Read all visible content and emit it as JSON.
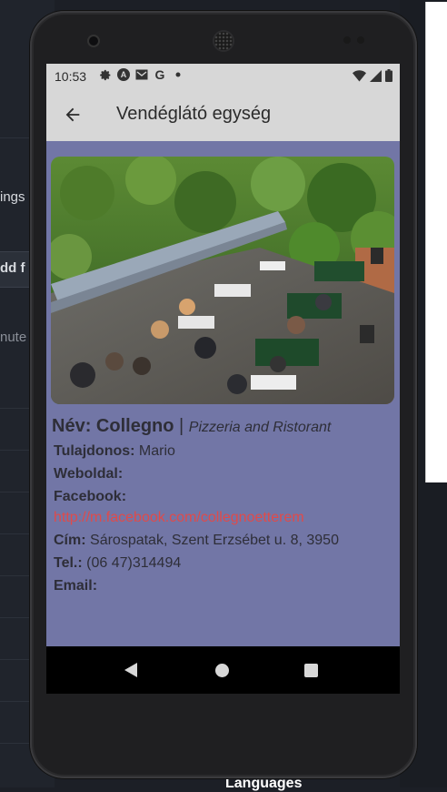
{
  "background": {
    "left_labels": [
      "ings",
      "dd f",
      "nute"
    ],
    "right_labels": [
      "ʃ"
    ],
    "bottom_label": "Languages"
  },
  "status_bar": {
    "time": "10:53",
    "icons": [
      "gear-icon",
      "a-icon",
      "mail-icon",
      "g-icon",
      "dot-icon",
      "wifi-icon",
      "signal-icon",
      "battery-icon"
    ],
    "g_label": "G",
    "a_label": "A"
  },
  "app_bar": {
    "title": "Vendéglátó egység"
  },
  "venue": {
    "name_label": "Név:",
    "name": "Collegno",
    "separator": "|",
    "type": "Pizzeria and Ristorant",
    "owner_label": "Tulajdonos:",
    "owner": "Mario",
    "website_label": "Weboldal:",
    "website": "",
    "facebook_label": "Facebook:",
    "facebook": "http://m.facebook.com/collegnoetterem",
    "address_label": "Cím:",
    "address": "Sárospatak, Szent Erzsébet u. 8, 3950",
    "phone_label": "Tel.:",
    "phone": "(06 47)314494",
    "email_label": "Email:",
    "email": ""
  },
  "colors": {
    "screen_bg": "#7276a6",
    "bar_bg": "#d7d7d7",
    "link": "#e04a4a"
  }
}
